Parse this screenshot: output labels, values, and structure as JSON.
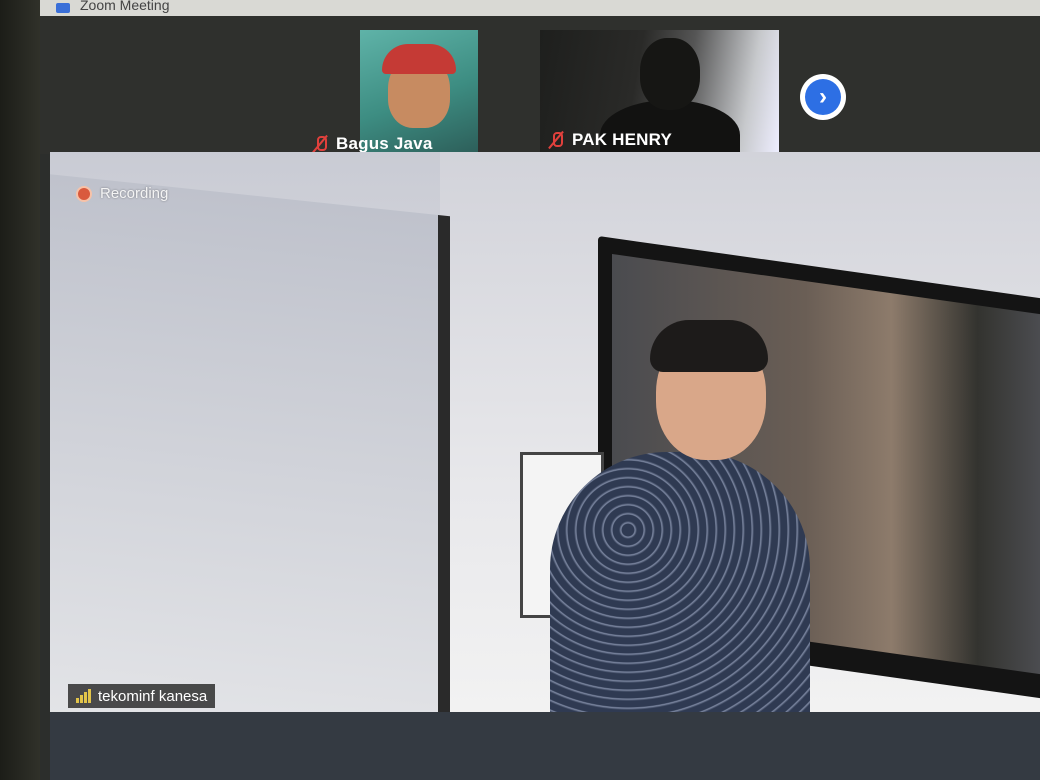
{
  "window": {
    "title": "Zoom Meeting"
  },
  "gallery": {
    "participants": [
      {
        "name": "Bagus Java",
        "muted": true
      },
      {
        "name": "PAK HENRY",
        "muted": true
      }
    ],
    "next_icon": "chevron-right-icon"
  },
  "main_video": {
    "recording_label": "Recording",
    "speaker_name": "tekominf kanesa",
    "signal_icon": "signal-bars-icon"
  },
  "colors": {
    "accent": "#2d6fe4",
    "mute": "#e0403c",
    "recording": "#d95a3d",
    "signal": "#e2c44a"
  }
}
